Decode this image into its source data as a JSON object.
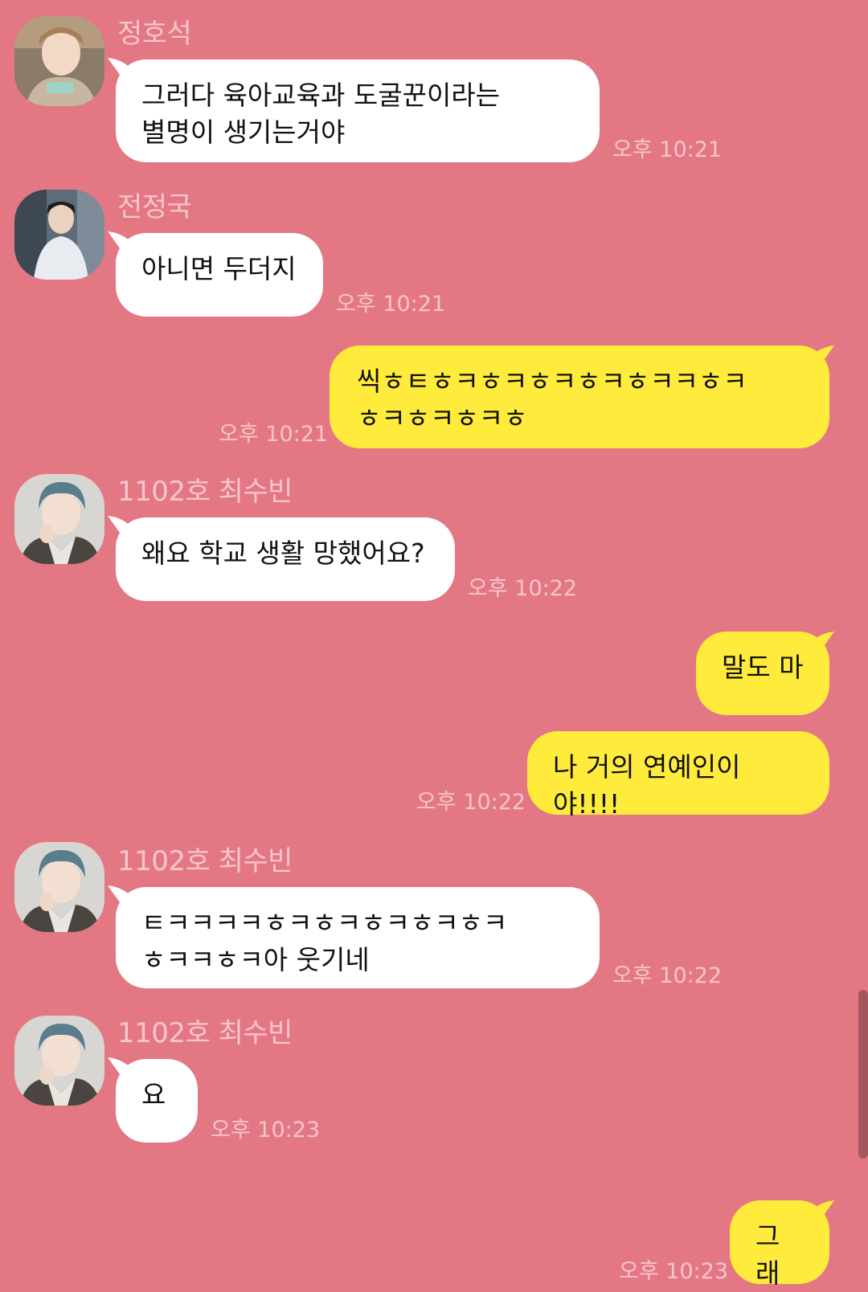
{
  "colors": {
    "background": "#E37884",
    "incoming_bubble": "#FFFFFF",
    "outgoing_bubble": "#FFEB3B",
    "meta_text": "#F7C5CB"
  },
  "messages": [
    {
      "sender": "정호석",
      "text": "그러다 육아교육과 도굴꾼이라는\n별명이 생기는거야",
      "time": "오후 10:21",
      "avatar": "jung-hoseok-avatar"
    },
    {
      "sender": "전정국",
      "text": "아니면 두더지",
      "time": "오후 10:21",
      "avatar": "jeon-jungkook-avatar"
    },
    {
      "text": "씩ㅎㅌㅎㅋㅎㅋㅎㅋㅎㅋㅎㅋㅋㅎㅋ\nㅎㅋㅎㅋㅎㅋㅎ",
      "time": "오후 10:21"
    },
    {
      "sender": "1102호 최수빈",
      "text": "왜요 학교 생활 망했어요?",
      "time": "오후 10:22",
      "avatar": "choi-soobin-avatar"
    },
    {
      "text": "말도 마"
    },
    {
      "text": "나 거의 연예인이야!!!!",
      "time": "오후 10:22"
    },
    {
      "sender": "1102호 최수빈",
      "text": "ㅌㅋㅋㅋㅋㅎㅋㅎㅋㅎㅋㅎㅋㅎㅋ\nㅎㅋㅋㅎㅋ아 웃기네",
      "time": "오후 10:22",
      "avatar": "choi-soobin-avatar"
    },
    {
      "sender": "1102호 최수빈",
      "text": "요",
      "time": "오후 10:23",
      "avatar": "choi-soobin-avatar"
    },
    {
      "text": "그래",
      "time": "오후 10:23"
    }
  ]
}
